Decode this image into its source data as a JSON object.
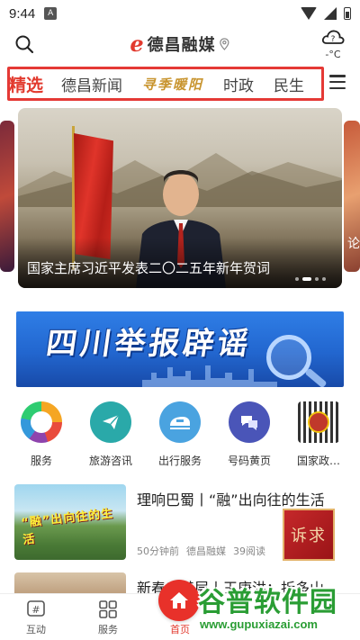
{
  "status_bar": {
    "time": "9:44",
    "notif_letter": "A"
  },
  "header": {
    "logo_mark": "e",
    "logo_text": "德昌融媒",
    "weather_temp": "-°C"
  },
  "tabs": [
    {
      "label": "精选",
      "active": true
    },
    {
      "label": "德昌新闻",
      "active": false
    },
    {
      "label": "寻季暖阳",
      "active": false
    },
    {
      "label": "时政",
      "active": false
    },
    {
      "label": "民生",
      "active": false
    }
  ],
  "carousel": {
    "caption": "国家主席习近平发表二〇二五年新年贺词",
    "right_peek_text": "论"
  },
  "banner": {
    "title": "四川举报辟谣"
  },
  "services": [
    {
      "label": "服务",
      "icon": "ring-icon",
      "color": "#f5a623"
    },
    {
      "label": "旅游咨讯",
      "icon": "paper-plane-icon",
      "color": "#2aa9a9"
    },
    {
      "label": "出行服务",
      "icon": "train-icon",
      "color": "#4aa3e0"
    },
    {
      "label": "号码黄页",
      "icon": "chat-icon",
      "color": "#4a55b8"
    },
    {
      "label": "国家政…",
      "icon": "emblem-qr-icon",
      "color": "#c0392b"
    }
  ],
  "news": [
    {
      "title": "理响巴蜀丨“融”出向往的生活",
      "time": "50分钟前",
      "source": "德昌融媒",
      "reads": "39阅读",
      "thumb_text": "“融”出向往的生活"
    },
    {
      "title": "新春走基层丨王庚洪：折多山"
    }
  ],
  "complaint_badge": "诉求",
  "tabbar": [
    {
      "label": "互动",
      "icon": "hash-icon"
    },
    {
      "label": "服务",
      "icon": "grid-icon"
    },
    {
      "label": "首页",
      "icon": "home-icon"
    },
    {
      "label": "",
      "icon": ""
    },
    {
      "label": "",
      "icon": ""
    }
  ],
  "watermark": {
    "text": "谷普软件园",
    "url": "www.gupuxiazai.com"
  }
}
